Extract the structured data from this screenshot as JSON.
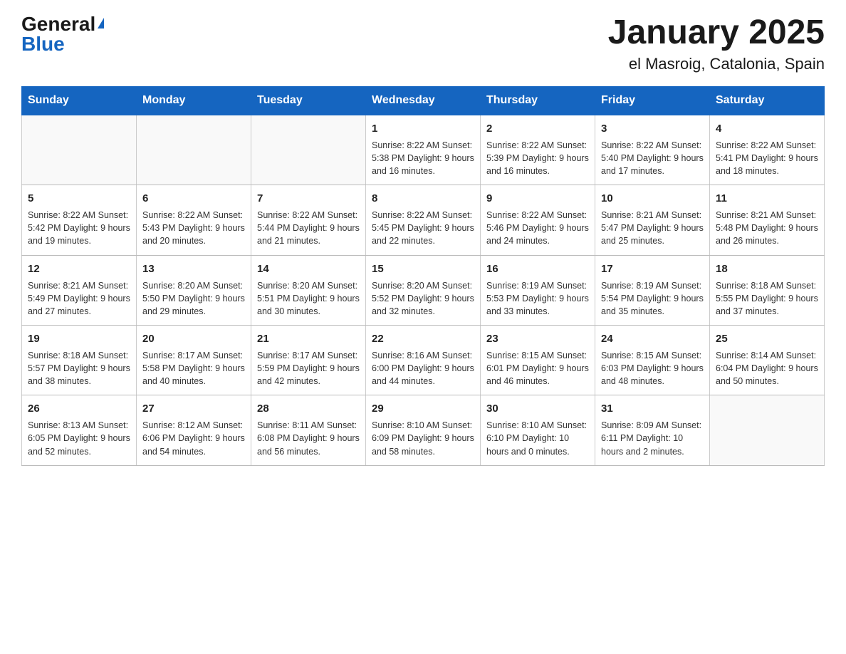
{
  "logo": {
    "general": "General",
    "triangle": "▶",
    "blue": "Blue"
  },
  "title": "January 2025",
  "subtitle": "el Masroig, Catalonia, Spain",
  "weekdays": [
    "Sunday",
    "Monday",
    "Tuesday",
    "Wednesday",
    "Thursday",
    "Friday",
    "Saturday"
  ],
  "weeks": [
    [
      {
        "day": "",
        "info": ""
      },
      {
        "day": "",
        "info": ""
      },
      {
        "day": "",
        "info": ""
      },
      {
        "day": "1",
        "info": "Sunrise: 8:22 AM\nSunset: 5:38 PM\nDaylight: 9 hours\nand 16 minutes."
      },
      {
        "day": "2",
        "info": "Sunrise: 8:22 AM\nSunset: 5:39 PM\nDaylight: 9 hours\nand 16 minutes."
      },
      {
        "day": "3",
        "info": "Sunrise: 8:22 AM\nSunset: 5:40 PM\nDaylight: 9 hours\nand 17 minutes."
      },
      {
        "day": "4",
        "info": "Sunrise: 8:22 AM\nSunset: 5:41 PM\nDaylight: 9 hours\nand 18 minutes."
      }
    ],
    [
      {
        "day": "5",
        "info": "Sunrise: 8:22 AM\nSunset: 5:42 PM\nDaylight: 9 hours\nand 19 minutes."
      },
      {
        "day": "6",
        "info": "Sunrise: 8:22 AM\nSunset: 5:43 PM\nDaylight: 9 hours\nand 20 minutes."
      },
      {
        "day": "7",
        "info": "Sunrise: 8:22 AM\nSunset: 5:44 PM\nDaylight: 9 hours\nand 21 minutes."
      },
      {
        "day": "8",
        "info": "Sunrise: 8:22 AM\nSunset: 5:45 PM\nDaylight: 9 hours\nand 22 minutes."
      },
      {
        "day": "9",
        "info": "Sunrise: 8:22 AM\nSunset: 5:46 PM\nDaylight: 9 hours\nand 24 minutes."
      },
      {
        "day": "10",
        "info": "Sunrise: 8:21 AM\nSunset: 5:47 PM\nDaylight: 9 hours\nand 25 minutes."
      },
      {
        "day": "11",
        "info": "Sunrise: 8:21 AM\nSunset: 5:48 PM\nDaylight: 9 hours\nand 26 minutes."
      }
    ],
    [
      {
        "day": "12",
        "info": "Sunrise: 8:21 AM\nSunset: 5:49 PM\nDaylight: 9 hours\nand 27 minutes."
      },
      {
        "day": "13",
        "info": "Sunrise: 8:20 AM\nSunset: 5:50 PM\nDaylight: 9 hours\nand 29 minutes."
      },
      {
        "day": "14",
        "info": "Sunrise: 8:20 AM\nSunset: 5:51 PM\nDaylight: 9 hours\nand 30 minutes."
      },
      {
        "day": "15",
        "info": "Sunrise: 8:20 AM\nSunset: 5:52 PM\nDaylight: 9 hours\nand 32 minutes."
      },
      {
        "day": "16",
        "info": "Sunrise: 8:19 AM\nSunset: 5:53 PM\nDaylight: 9 hours\nand 33 minutes."
      },
      {
        "day": "17",
        "info": "Sunrise: 8:19 AM\nSunset: 5:54 PM\nDaylight: 9 hours\nand 35 minutes."
      },
      {
        "day": "18",
        "info": "Sunrise: 8:18 AM\nSunset: 5:55 PM\nDaylight: 9 hours\nand 37 minutes."
      }
    ],
    [
      {
        "day": "19",
        "info": "Sunrise: 8:18 AM\nSunset: 5:57 PM\nDaylight: 9 hours\nand 38 minutes."
      },
      {
        "day": "20",
        "info": "Sunrise: 8:17 AM\nSunset: 5:58 PM\nDaylight: 9 hours\nand 40 minutes."
      },
      {
        "day": "21",
        "info": "Sunrise: 8:17 AM\nSunset: 5:59 PM\nDaylight: 9 hours\nand 42 minutes."
      },
      {
        "day": "22",
        "info": "Sunrise: 8:16 AM\nSunset: 6:00 PM\nDaylight: 9 hours\nand 44 minutes."
      },
      {
        "day": "23",
        "info": "Sunrise: 8:15 AM\nSunset: 6:01 PM\nDaylight: 9 hours\nand 46 minutes."
      },
      {
        "day": "24",
        "info": "Sunrise: 8:15 AM\nSunset: 6:03 PM\nDaylight: 9 hours\nand 48 minutes."
      },
      {
        "day": "25",
        "info": "Sunrise: 8:14 AM\nSunset: 6:04 PM\nDaylight: 9 hours\nand 50 minutes."
      }
    ],
    [
      {
        "day": "26",
        "info": "Sunrise: 8:13 AM\nSunset: 6:05 PM\nDaylight: 9 hours\nand 52 minutes."
      },
      {
        "day": "27",
        "info": "Sunrise: 8:12 AM\nSunset: 6:06 PM\nDaylight: 9 hours\nand 54 minutes."
      },
      {
        "day": "28",
        "info": "Sunrise: 8:11 AM\nSunset: 6:08 PM\nDaylight: 9 hours\nand 56 minutes."
      },
      {
        "day": "29",
        "info": "Sunrise: 8:10 AM\nSunset: 6:09 PM\nDaylight: 9 hours\nand 58 minutes."
      },
      {
        "day": "30",
        "info": "Sunrise: 8:10 AM\nSunset: 6:10 PM\nDaylight: 10 hours\nand 0 minutes."
      },
      {
        "day": "31",
        "info": "Sunrise: 8:09 AM\nSunset: 6:11 PM\nDaylight: 10 hours\nand 2 minutes."
      },
      {
        "day": "",
        "info": ""
      }
    ]
  ]
}
